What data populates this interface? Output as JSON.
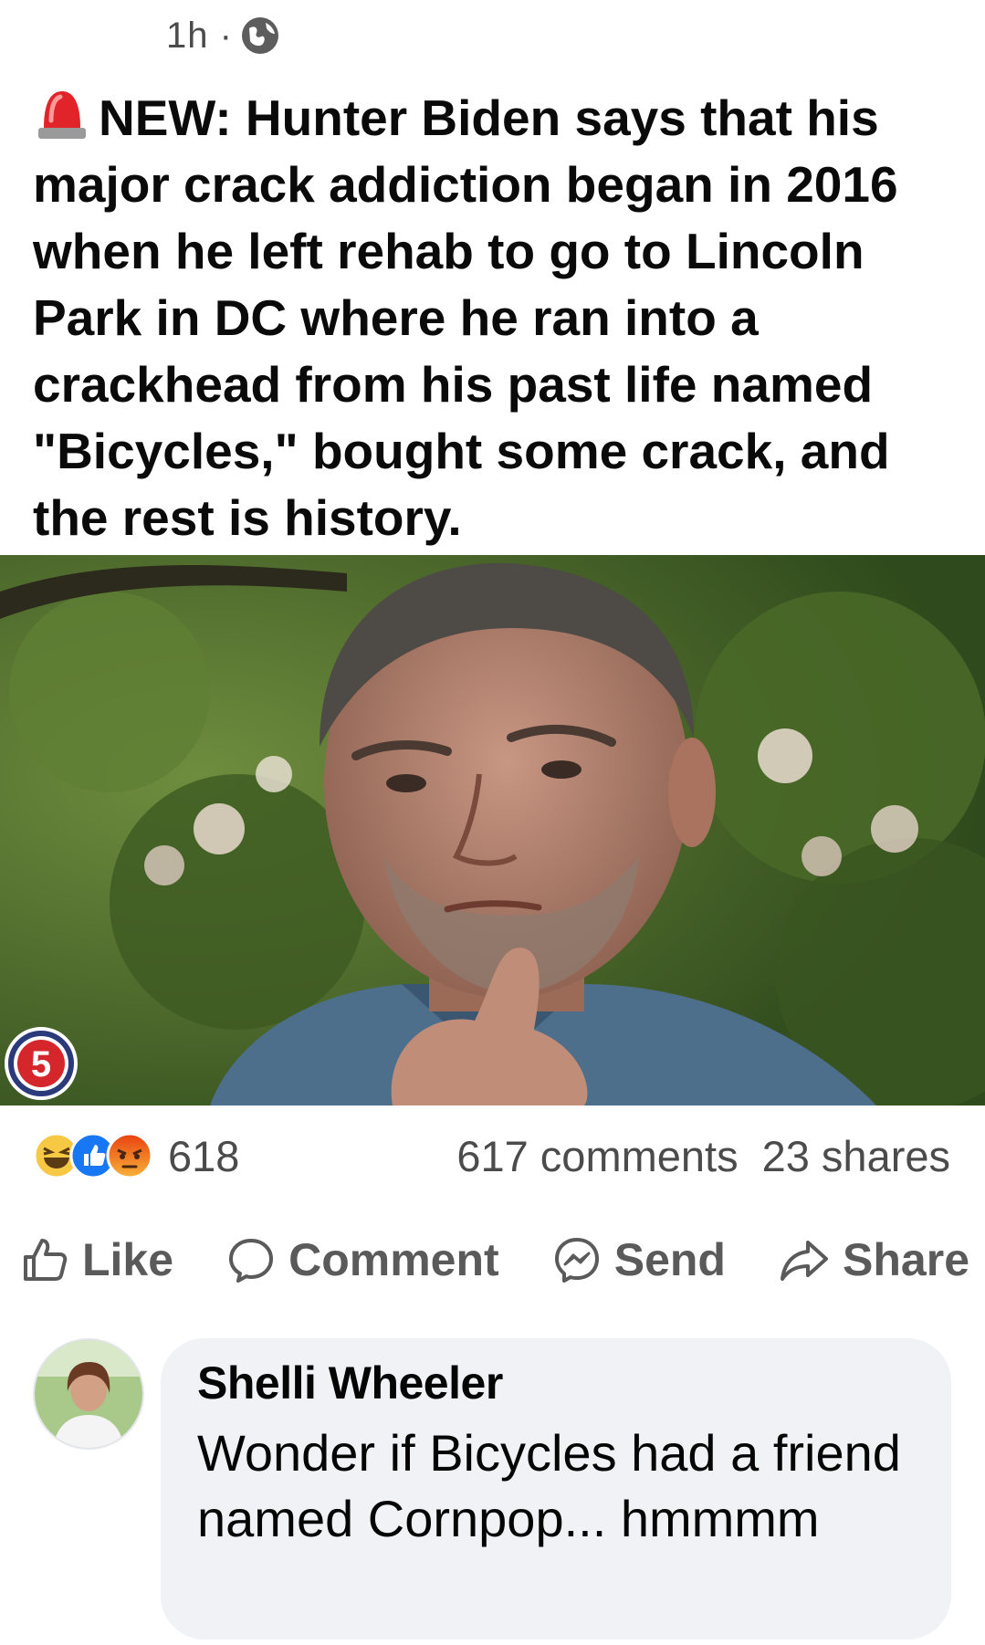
{
  "post": {
    "time": "1h ·",
    "text": "NEW: Hunter Biden says that his major crack addiction began in 2016 when he left rehab to go to Lincoln Park in DC where he ran into a crackhead from his past life named \"Bicycles,\" bought some crack, and the rest is history.",
    "channel_logo": "5"
  },
  "stats": {
    "reaction_count": "618",
    "comments": "617 comments",
    "shares": "23 shares"
  },
  "actions": {
    "like": "Like",
    "comment": "Comment",
    "send": "Send",
    "share": "Share"
  },
  "comment": {
    "author": "Shelli Wheeler",
    "text": "Wonder if Bicycles had a friend named Cornpop... hmmmm"
  },
  "colors": {
    "like_blue": "#1877f2",
    "haha_yellow": "#f7c844",
    "angry_red": "#e9710f",
    "muted_text": "#65676b",
    "bubble_bg": "#f0f2f5",
    "siren_red": "#e0242a"
  },
  "icons": [
    "globe-icon",
    "siren-icon",
    "haha-reaction-icon",
    "like-reaction-icon",
    "angry-reaction-icon",
    "like-icon",
    "comment-icon",
    "messenger-icon",
    "share-icon"
  ]
}
